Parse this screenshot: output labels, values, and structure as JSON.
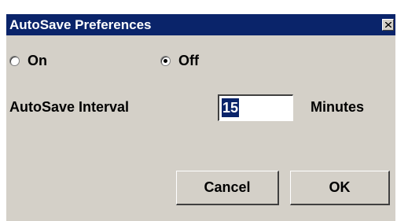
{
  "window": {
    "title": "AutoSave Preferences",
    "close_icon": "close-icon"
  },
  "mode": {
    "options": [
      {
        "label": "On",
        "checked": false
      },
      {
        "label": "Off",
        "checked": true
      }
    ]
  },
  "interval": {
    "label": "AutoSave Interval",
    "value": "15",
    "unit": "Minutes"
  },
  "buttons": {
    "cancel_label": "Cancel",
    "ok_label": "OK"
  },
  "colors": {
    "titlebar": "#0a246a",
    "dialog_bg": "#d4d0c8",
    "selection": "#0a246a"
  }
}
